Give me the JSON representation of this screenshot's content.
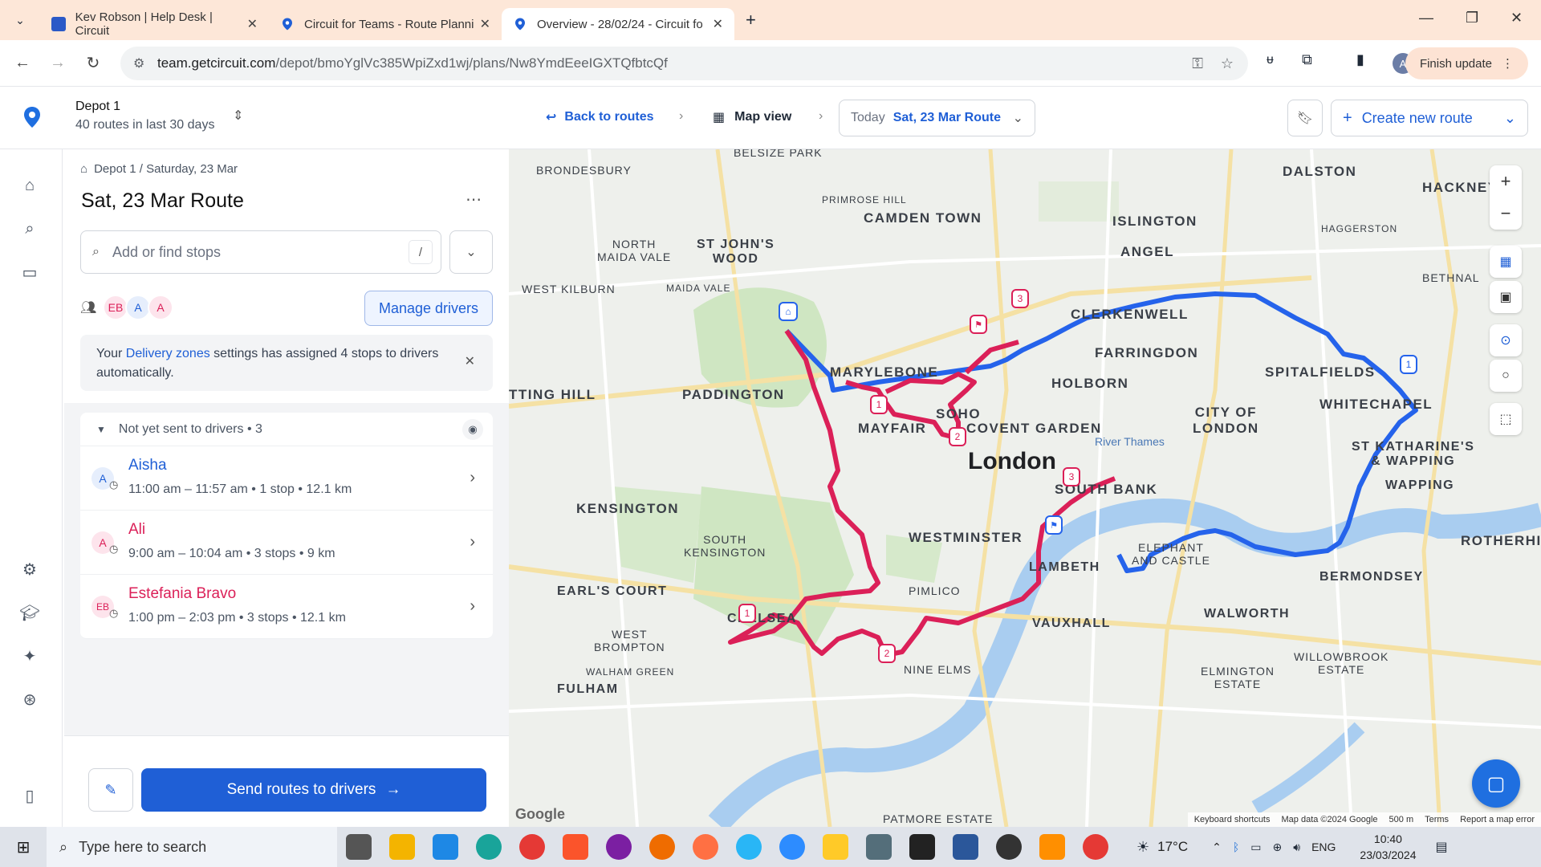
{
  "browser": {
    "tabs": [
      {
        "title": "Kev Robson | Help Desk | Circuit",
        "active": false
      },
      {
        "title": "Circuit for Teams - Route Planni",
        "active": false
      },
      {
        "title": "Overview - 28/02/24 - Circuit fo",
        "active": true
      }
    ],
    "url_host": "team.getcircuit.com",
    "url_path": "/depot/bmoYglVc385WpiZxd1wj/plans/Nw8YmdEeeIGXTQfbtcQf",
    "profile_initial": "A",
    "finish_update": "Finish update"
  },
  "header": {
    "depot_name": "Depot 1",
    "depot_sub": "40 routes in last 30 days",
    "back_to_routes": "Back to routes",
    "map_view": "Map view",
    "today_label": "Today",
    "route_select": "Sat, 23 Mar Route",
    "create_route": "Create new route"
  },
  "panel": {
    "breadcrumb": "Depot 1 / Saturday, 23 Mar",
    "title": "Sat, 23 Mar Route",
    "search_placeholder": "Add or find stops",
    "search_shortcut": "/",
    "avatars": [
      "EB",
      "A",
      "A"
    ],
    "manage_drivers": "Manage drivers",
    "notice_pre": "Your ",
    "notice_link": "Delivery zones",
    "notice_post": " settings has assigned 4 stops to drivers automatically.",
    "group_label": "Not yet sent to drivers • 3",
    "drivers": [
      {
        "initials": "A",
        "name": "Aisha",
        "meta": "11:00 am – 11:57 am • 1 stop • 12.1 km",
        "color": "#1f5fd6",
        "bg": "#e6eefc"
      },
      {
        "initials": "A",
        "name": "Ali",
        "meta": "9:00 am – 10:04 am • 3 stops • 9 km",
        "color": "#db2058",
        "bg": "#fde4ec"
      },
      {
        "initials": "EB",
        "name": "Estefania Bravo",
        "meta": "1:00 pm – 2:03 pm • 3 stops • 12.1 km",
        "color": "#db2058",
        "bg": "#fde4ec"
      }
    ],
    "send_button": "Send routes to drivers"
  },
  "map": {
    "labels": {
      "belsize_park": "BELSIZE PARK",
      "brondesbury": "BRONDESBURY",
      "primrose_hill": "PRIMROSE HILL",
      "camden_town": "CAMDEN TOWN",
      "islington": "ISLINGTON",
      "dalston": "DALSTON",
      "hackney": "HACKNEY",
      "haggerston": "HAGGERSTON",
      "north_maida_vale": "NORTH\nMAIDA VALE",
      "st_johns_wood": "ST JOHN'S\nWOOD",
      "angel": "ANGEL",
      "west_kilburn": "WEST KILBURN",
      "maida_vale": "MAIDA VALE",
      "clerkenwell": "CLERKENWELL",
      "bethnal": "BETHNAL",
      "farringdon": "FARRINGDON",
      "marylebone": "MARYLEBONE",
      "holborn": "HOLBORN",
      "spitalfields": "SPITALFIELDS",
      "paddington": "PADDINGTON",
      "notting_hill": "TTING HILL",
      "whitechapel": "WHITECHAPEL",
      "soho": "SOHO",
      "mayfair": "MAYFAIR",
      "covent_garden": "COVENT GARDEN",
      "city_of_london": "CITY OF\nLONDON",
      "london": "London",
      "river_thames": "River Thames",
      "st_katharines": "ST KATHARINE'S\n& WAPPING",
      "wapping": "WAPPING",
      "south_bank": "SOUTH BANK",
      "kensington": "KENSINGTON",
      "westminster": "WESTMINSTER",
      "south_kensington": "SOUTH\nKENSINGTON",
      "elephant": "ELEPHANT\nAND CASTLE",
      "lambeth": "LAMBETH",
      "rotherhithe": "ROTHERHI",
      "bermondsey": "BERMONDSEY",
      "earls_court": "EARL'S COURT",
      "pimlico": "PIMLICO",
      "chelsea": "CHELSEA",
      "vauxhall": "VAUXHALL",
      "walworth": "WALWORTH",
      "west_brompton": "WEST\nBROMPTON",
      "walham_green": "WALHAM GREEN",
      "nine_elms": "NINE ELMS",
      "fulham": "FULHAM",
      "elmington": "ELMINGTON\nESTATE",
      "willowbrook": "WILLOWBROOK\nESTATE",
      "patmore": "PATMORE ESTATE"
    },
    "footer": {
      "shortcuts": "Keyboard shortcuts",
      "mapdata": "Map data ©2024 Google",
      "scale": "500 m",
      "terms": "Terms",
      "report": "Report a map error"
    }
  },
  "taskbar": {
    "search_placeholder": "Type here to search",
    "temp": "17°C",
    "lang": "ENG",
    "time": "10:40",
    "date": "23/03/2024"
  },
  "colors": {
    "blue_route": "#2563eb",
    "pink_route": "#db2058",
    "brand": "#1f5fd6"
  }
}
